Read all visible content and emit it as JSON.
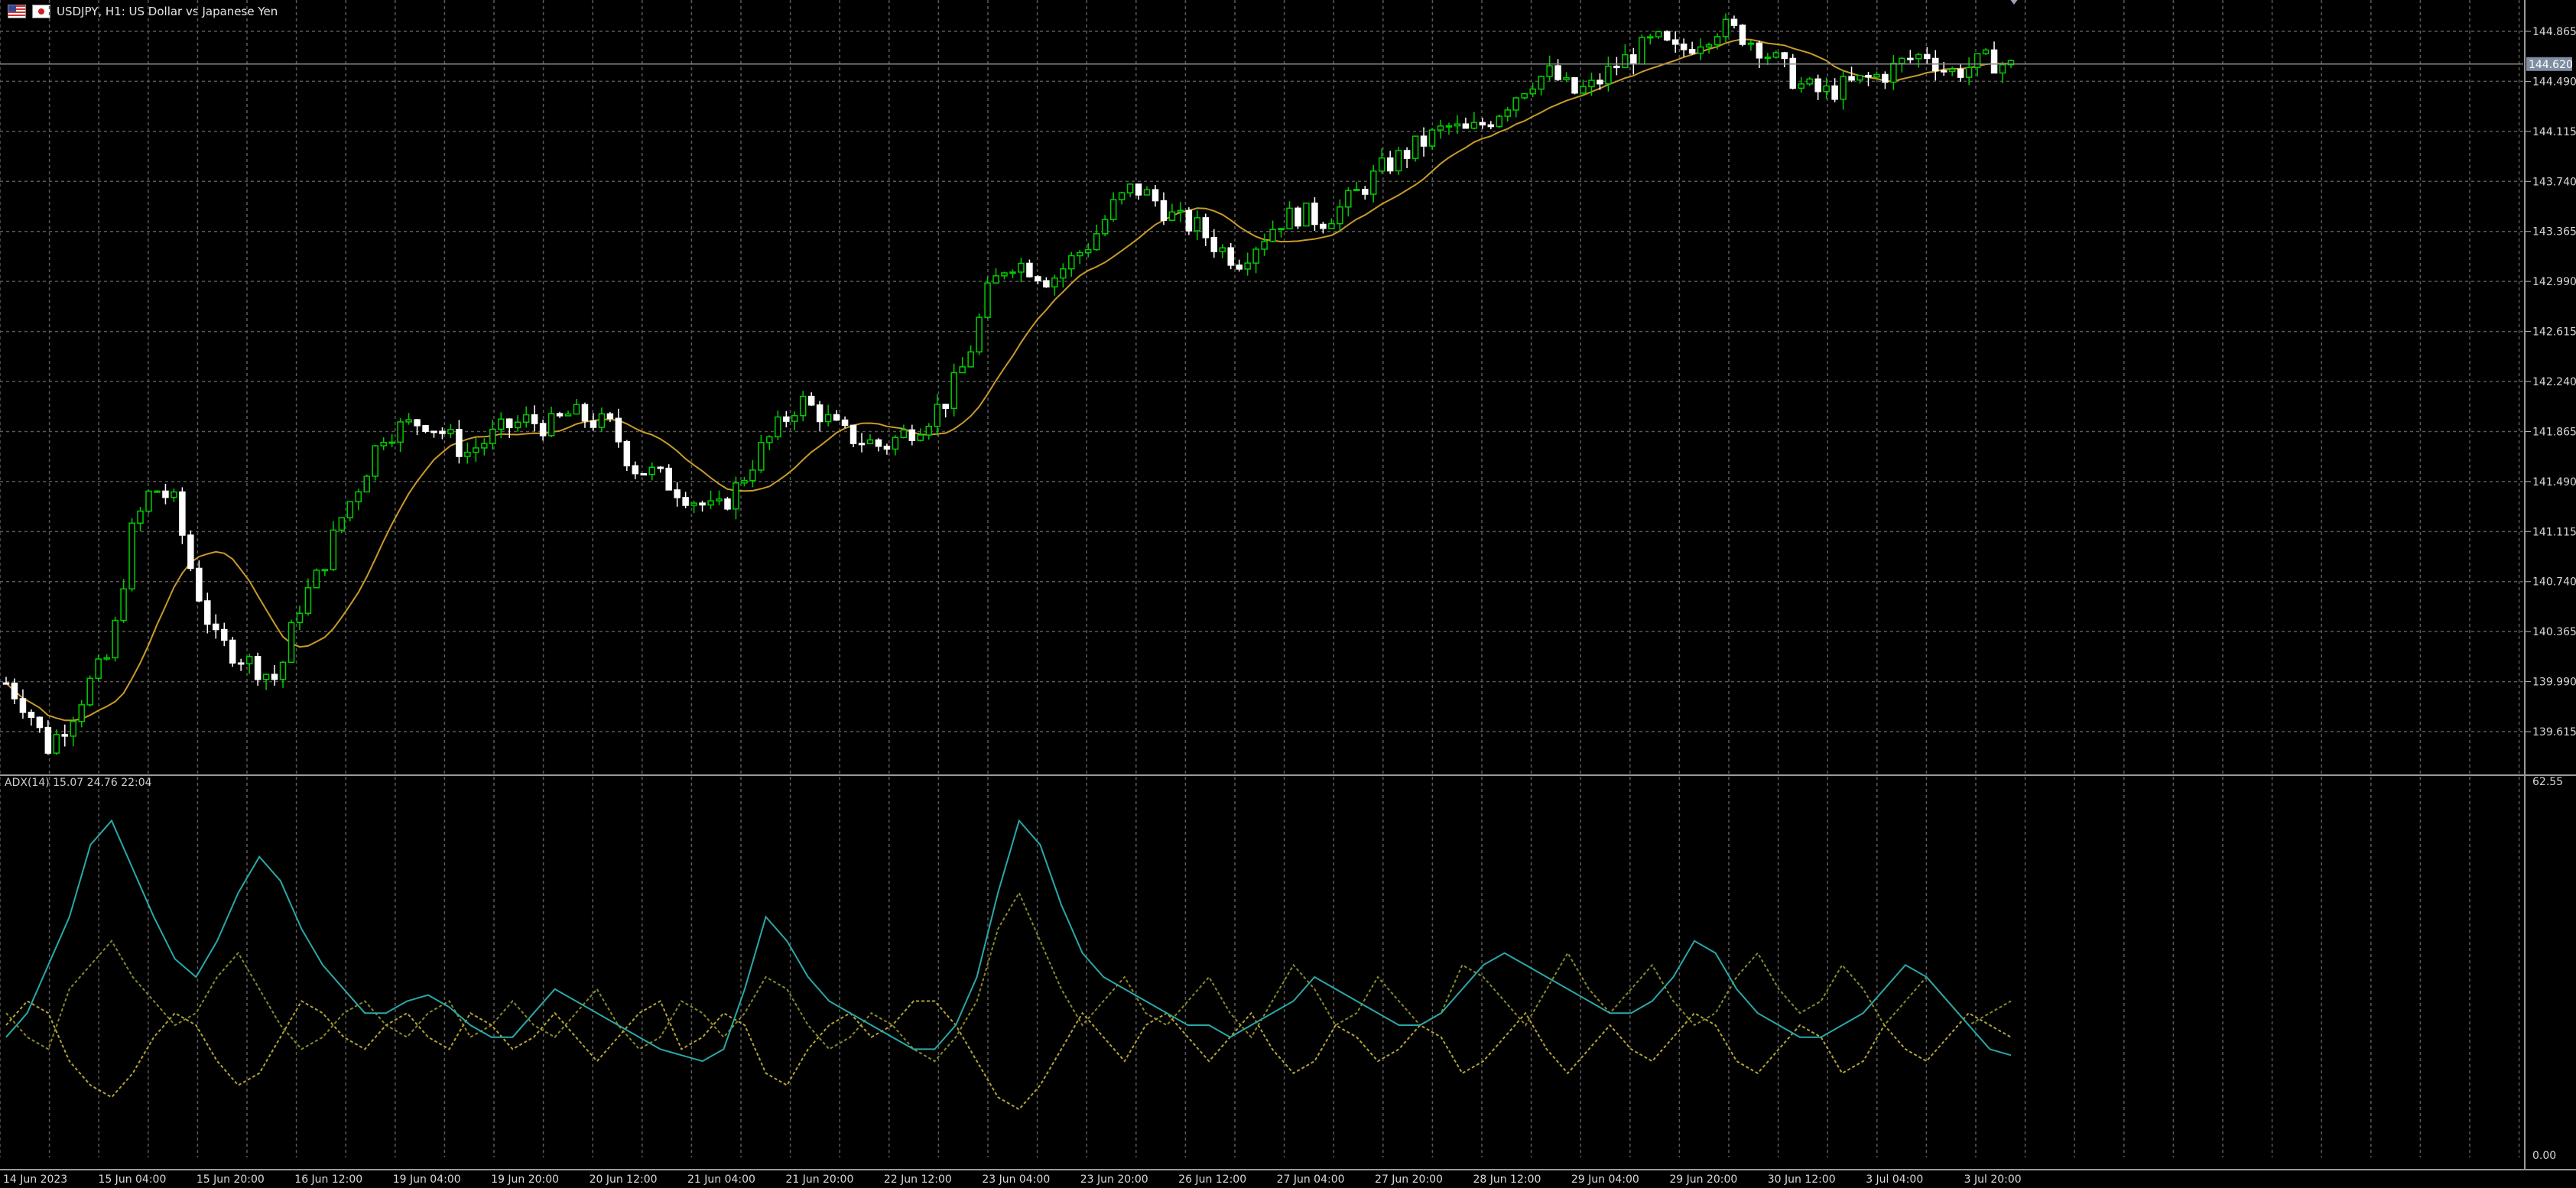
{
  "window": {
    "title": "USDJPY, H1:  US Dollar vs Japanese Yen",
    "flags": [
      "us-flag-icon",
      "jp-flag-icon"
    ]
  },
  "indicator": {
    "label": "ADX(14) 15.07 24.76 22:04",
    "scale_max": "62.55",
    "scale_min": "0.00"
  },
  "current_price": "144.620",
  "colors": {
    "background": "#000000",
    "bull_candle": "#00cc00",
    "bear_candle": "#ffffff",
    "moving_average": "#c89a2a",
    "adx_line": "#2aa8a8",
    "plus_di": "#8a8a2a",
    "minus_di": "#b5a53a",
    "grid": "#5a5a5a",
    "price_tag_bg": "#7f8ea0"
  },
  "chart_data": {
    "type": "candlestick",
    "symbol": "USDJPY",
    "timeframe": "H1",
    "price_axis_labels": [
      "144.865",
      "144.490",
      "144.115",
      "143.740",
      "143.365",
      "142.990",
      "142.615",
      "142.240",
      "141.865",
      "141.490",
      "141.115",
      "140.740",
      "140.365",
      "139.990",
      "139.615"
    ],
    "ylim": [
      139.3,
      145.1
    ],
    "time_axis_labels": [
      "14 Jun 2023",
      "15 Jun 04:00",
      "15 Jun 20:00",
      "16 Jun 12:00",
      "19 Jun 04:00",
      "19 Jun 20:00",
      "20 Jun 12:00",
      "21 Jun 04:00",
      "21 Jun 20:00",
      "22 Jun 12:00",
      "23 Jun 04:00",
      "23 Jun 20:00",
      "26 Jun 12:00",
      "27 Jun 04:00",
      "27 Jun 20:00",
      "28 Jun 12:00",
      "29 Jun 04:00",
      "29 Jun 20:00",
      "30 Jun 12:00",
      "3 Jul 04:00",
      "3 Jul 20:00"
    ],
    "bar_count": 240,
    "close_path": [
      [
        0,
        139.98
      ],
      [
        6,
        139.8
      ],
      [
        12,
        139.5
      ],
      [
        18,
        139.7
      ],
      [
        24,
        139.98
      ],
      [
        30,
        140.2
      ],
      [
        36,
        141.1
      ],
      [
        42,
        141.45
      ],
      [
        48,
        141.35
      ],
      [
        54,
        140.75
      ],
      [
        60,
        140.3
      ],
      [
        66,
        140.2
      ],
      [
        72,
        140.1
      ],
      [
        78,
        140.0
      ],
      [
        84,
        140.55
      ],
      [
        90,
        140.8
      ],
      [
        96,
        141.2
      ],
      [
        102,
        141.5
      ],
      [
        108,
        141.85
      ],
      [
        114,
        141.9
      ],
      [
        120,
        141.95
      ],
      [
        126,
        141.85
      ],
      [
        132,
        141.7
      ],
      [
        138,
        141.8
      ],
      [
        144,
        141.9
      ],
      [
        150,
        141.95
      ],
      [
        156,
        141.9
      ],
      [
        162,
        142.0
      ],
      [
        168,
        141.95
      ],
      [
        174,
        141.9
      ],
      [
        180,
        141.6
      ],
      [
        186,
        141.55
      ],
      [
        192,
        141.45
      ],
      [
        198,
        141.35
      ],
      [
        204,
        141.25
      ],
      [
        210,
        141.45
      ],
      [
        216,
        141.7
      ],
      [
        222,
        141.9
      ],
      [
        228,
        142.1
      ],
      [
        234,
        142.0
      ],
      [
        240,
        141.85
      ],
      [
        246,
        141.8
      ],
      [
        252,
        141.75
      ],
      [
        258,
        141.85
      ],
      [
        264,
        141.95
      ],
      [
        270,
        142.1
      ],
      [
        276,
        142.4
      ],
      [
        282,
        142.9
      ],
      [
        288,
        143.15
      ],
      [
        294,
        143.1
      ],
      [
        300,
        143.0
      ],
      [
        306,
        143.15
      ],
      [
        312,
        143.3
      ],
      [
        318,
        143.55
      ],
      [
        324,
        143.7
      ],
      [
        330,
        143.6
      ],
      [
        336,
        143.45
      ],
      [
        342,
        143.4
      ],
      [
        348,
        143.25
      ],
      [
        354,
        143.15
      ],
      [
        360,
        143.3
      ],
      [
        366,
        143.45
      ],
      [
        372,
        143.5
      ],
      [
        378,
        143.45
      ],
      [
        384,
        143.55
      ],
      [
        390,
        143.7
      ],
      [
        396,
        143.85
      ],
      [
        402,
        143.95
      ],
      [
        408,
        144.05
      ],
      [
        414,
        144.15
      ],
      [
        420,
        144.1
      ],
      [
        426,
        144.2
      ],
      [
        432,
        144.35
      ],
      [
        438,
        144.5
      ],
      [
        444,
        144.55
      ],
      [
        450,
        144.4
      ],
      [
        456,
        144.45
      ],
      [
        462,
        144.6
      ],
      [
        468,
        144.7
      ],
      [
        474,
        144.8
      ],
      [
        480,
        144.7
      ],
      [
        486,
        144.8
      ],
      [
        492,
        144.9
      ],
      [
        498,
        144.85
      ],
      [
        504,
        144.75
      ],
      [
        510,
        144.6
      ],
      [
        516,
        144.45
      ],
      [
        522,
        144.4
      ],
      [
        528,
        144.45
      ],
      [
        534,
        144.5
      ],
      [
        540,
        144.55
      ],
      [
        546,
        144.65
      ],
      [
        552,
        144.7
      ],
      [
        558,
        144.55
      ],
      [
        564,
        144.6
      ],
      [
        570,
        144.65
      ],
      [
        576,
        144.6
      ]
    ],
    "moving_average": {
      "name": "MA",
      "color": "#c89a2a"
    },
    "indicator": {
      "name": "ADX(14)",
      "ylim": [
        0,
        62.55
      ],
      "adx": [
        20,
        24,
        32,
        40,
        52,
        56,
        48,
        40,
        33,
        30,
        36,
        44,
        50,
        46,
        38,
        32,
        28,
        24,
        24,
        26,
        27,
        25,
        22,
        20,
        20,
        24,
        28,
        26,
        24,
        22,
        20,
        18,
        17,
        16,
        18,
        28,
        40,
        36,
        30,
        26,
        24,
        22,
        20,
        18,
        18,
        22,
        30,
        44,
        56,
        52,
        42,
        34,
        30,
        28,
        26,
        24,
        22,
        22,
        20,
        22,
        24,
        26,
        30,
        28,
        26,
        24,
        22,
        22,
        24,
        28,
        32,
        34,
        32,
        30,
        28,
        26,
        24,
        24,
        26,
        30,
        36,
        34,
        28,
        24,
        22,
        20,
        20,
        22,
        24,
        28,
        32,
        30,
        26,
        22,
        18,
        17
      ],
      "plus_di": [
        24,
        20,
        18,
        28,
        32,
        36,
        30,
        26,
        22,
        24,
        30,
        34,
        28,
        22,
        18,
        20,
        24,
        26,
        22,
        20,
        24,
        26,
        20,
        22,
        26,
        22,
        20,
        24,
        28,
        22,
        18,
        20,
        26,
        24,
        20,
        24,
        30,
        28,
        22,
        18,
        20,
        24,
        22,
        18,
        16,
        20,
        26,
        38,
        44,
        36,
        28,
        22,
        26,
        30,
        24,
        22,
        26,
        30,
        24,
        20,
        26,
        32,
        28,
        22,
        24,
        30,
        26,
        22,
        24,
        32,
        30,
        26,
        22,
        28,
        34,
        28,
        24,
        28,
        32,
        26,
        22,
        24,
        30,
        34,
        28,
        24,
        26,
        32,
        28,
        22,
        26,
        30,
        26,
        22,
        24,
        26
      ],
      "minus_di": [
        22,
        26,
        24,
        16,
        12,
        10,
        14,
        20,
        24,
        22,
        16,
        12,
        14,
        20,
        26,
        24,
        20,
        18,
        22,
        24,
        20,
        18,
        24,
        22,
        18,
        20,
        24,
        20,
        16,
        20,
        24,
        26,
        18,
        20,
        24,
        22,
        14,
        12,
        18,
        22,
        24,
        20,
        22,
        26,
        26,
        22,
        16,
        10,
        8,
        12,
        18,
        24,
        20,
        16,
        22,
        24,
        20,
        16,
        20,
        24,
        18,
        14,
        16,
        22,
        20,
        16,
        18,
        22,
        20,
        14,
        16,
        20,
        24,
        18,
        14,
        18,
        22,
        18,
        16,
        20,
        24,
        22,
        16,
        14,
        18,
        22,
        20,
        14,
        16,
        22,
        18,
        16,
        20,
        24,
        22,
        20
      ]
    }
  }
}
